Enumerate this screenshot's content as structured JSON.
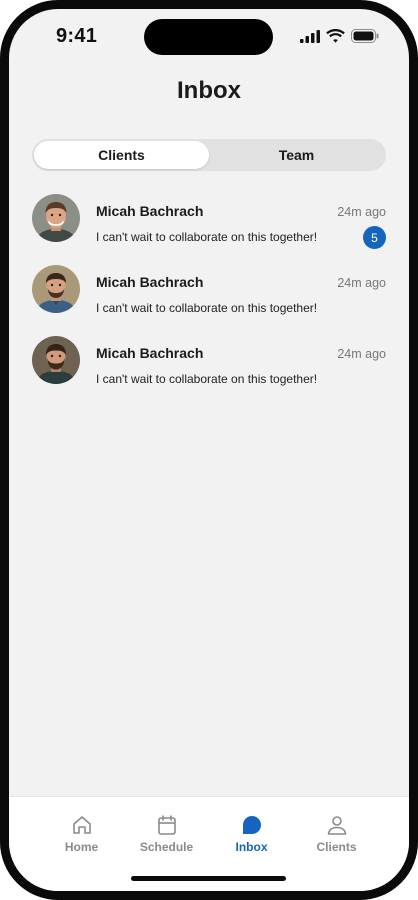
{
  "status_bar": {
    "time": "9:41",
    "icons": [
      "signal-icon",
      "wifi-icon",
      "battery-icon"
    ]
  },
  "header": {
    "title": "Inbox"
  },
  "segmented": {
    "options": [
      {
        "label": "Clients",
        "selected": true
      },
      {
        "label": "Team",
        "selected": false
      }
    ]
  },
  "messages": [
    {
      "name": "Micah Bachrach",
      "time": "24m ago",
      "preview": "I can't wait to collaborate on this together!",
      "unread": "5",
      "avatar": "avatar-photo"
    },
    {
      "name": "Micah Bachrach",
      "time": "24m ago",
      "preview": "I can't wait to collaborate on this together!",
      "avatar": "avatar-photo"
    },
    {
      "name": "Micah Bachrach",
      "time": "24m ago",
      "preview": "I can't wait to collaborate on this together!",
      "avatar": "avatar-photo"
    }
  ],
  "tab_bar": {
    "items": [
      {
        "label": "Home",
        "icon": "home-icon"
      },
      {
        "label": "Schedule",
        "icon": "calendar-icon"
      },
      {
        "label": "Inbox",
        "icon": "chat-bubble-icon",
        "active": true
      },
      {
        "label": "Clients",
        "icon": "person-icon"
      }
    ]
  },
  "colors": {
    "accent": "#1565c0",
    "background": "#f2f2f2",
    "segment_track": "#e1e1e1",
    "inactive_tab": "#8a8a8a"
  }
}
